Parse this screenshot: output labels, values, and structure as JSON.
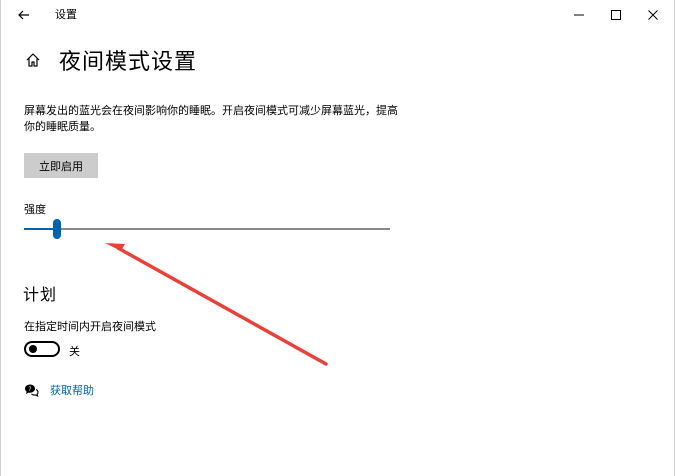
{
  "window": {
    "app_title": "设置",
    "controls": {
      "minimize": "–",
      "maximize": "□",
      "close": "✕"
    }
  },
  "page": {
    "title": "夜间模式设置",
    "description": "屏幕发出的蓝光会在夜间影响你的睡眠。开启夜间模式可减少屏幕蓝光，提高你的睡眠质量。",
    "action_button": "立即启用"
  },
  "strength": {
    "label": "强度",
    "value": 0.09
  },
  "schedule": {
    "heading": "计划",
    "toggle_label": "在指定时间内开启夜间模式",
    "toggle_state": "关"
  },
  "help": {
    "link_text": "获取帮助"
  },
  "colors": {
    "accent": "#0063b1",
    "annotation_arrow": "#e8413a",
    "button_bg": "#cccccc"
  },
  "icons": {
    "back": "back-arrow-icon",
    "home": "home-icon",
    "help": "help-chat-icon"
  }
}
